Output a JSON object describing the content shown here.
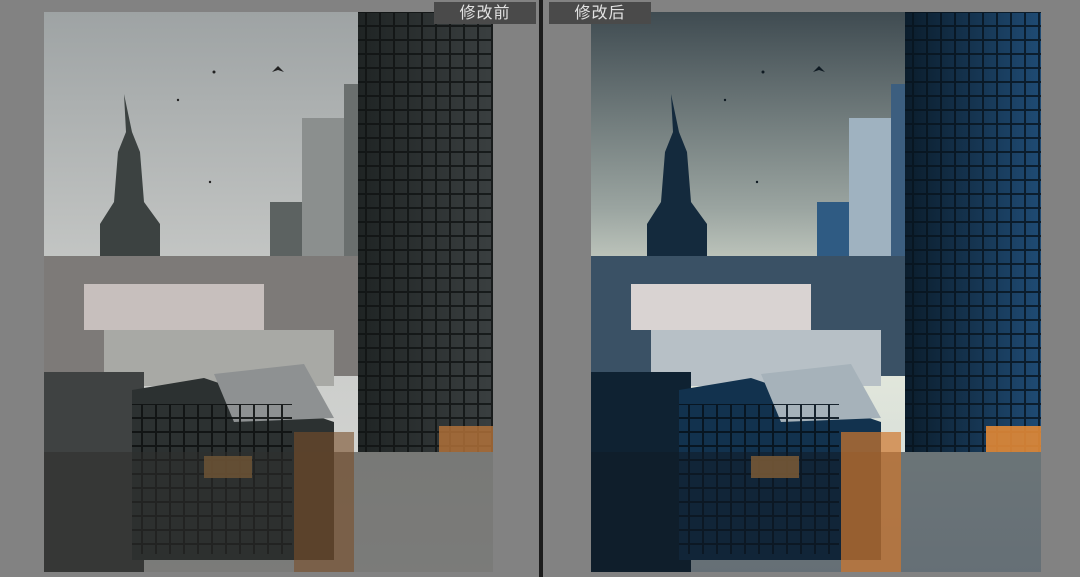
{
  "panels": {
    "before": {
      "label": "修改前",
      "colors": {
        "sky_top": "#b9bdbd",
        "sky_bottom": "#d6d8d6",
        "building": "#2f3434",
        "building_light": "#6f7473",
        "glass": "#24292a",
        "ground": "#3a3b38",
        "accent": "#d98a3c"
      }
    },
    "after": {
      "label": "修改后",
      "colors": {
        "sky_top": "#3e4a52",
        "sky_bottom": "#e7ecdc",
        "building": "#1a2c3c",
        "building_light": "#7f9cb6",
        "glass": "#0e2b4a",
        "ground": "#1b2a36",
        "accent": "#f39a3a"
      }
    }
  },
  "icons": {
    "divider": "vertical-divider",
    "birds": "bird-icon"
  }
}
